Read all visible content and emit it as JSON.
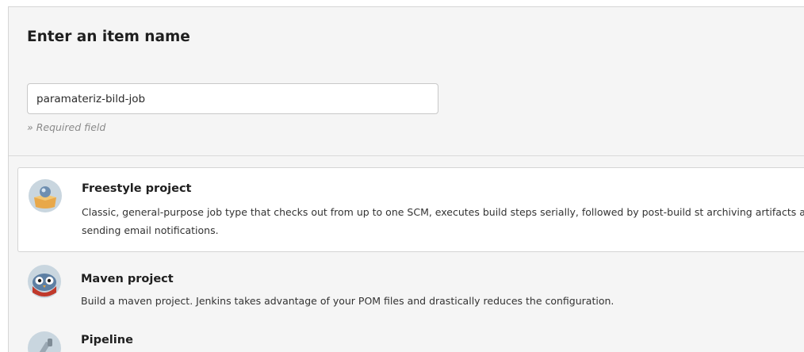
{
  "header": {
    "title": "Enter an item name",
    "name_input": {
      "value": "paramateriz-bild-job"
    },
    "required_note": "» Required field"
  },
  "job_types": [
    {
      "name": "Freestyle project",
      "description": "Classic, general-purpose job type that checks out from up to one SCM, executes build steps serially, followed by post-build st archiving artifacts and sending email notifications.",
      "icon": "freestyle-box-icon",
      "selected": true
    },
    {
      "name": "Maven project",
      "description": "Build a maven project. Jenkins takes advantage of your POM files and drastically reduces the configuration.",
      "icon": "maven-owl-icon",
      "selected": false
    },
    {
      "name": "Pipeline",
      "description": "",
      "icon": "pipeline-icon",
      "selected": false
    }
  ],
  "colors": {
    "panel_background": "#f5f5f5",
    "selected_background": "#ffffff",
    "border": "#d4d4d4"
  }
}
